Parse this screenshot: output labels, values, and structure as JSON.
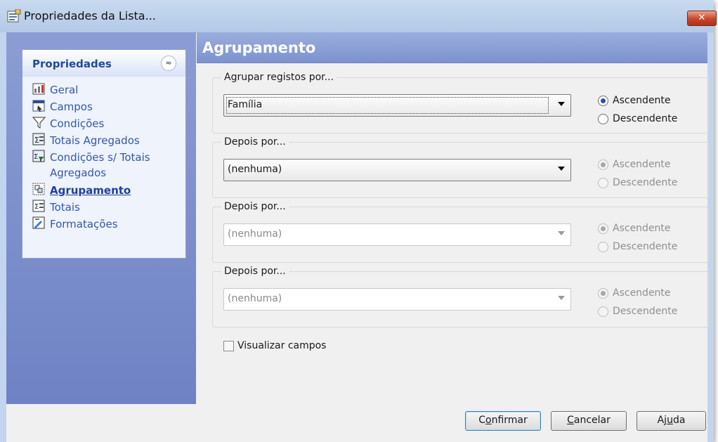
{
  "window": {
    "title": "Propriedades da Lista...",
    "close_glyph": "✕"
  },
  "sidebar": {
    "header": "Propriedades",
    "collapse_glyph": "≈",
    "items": [
      {
        "label": "Geral",
        "icon": "general-icon"
      },
      {
        "label": "Campos",
        "icon": "fields-icon"
      },
      {
        "label": "Condições",
        "icon": "filter-icon"
      },
      {
        "label": "Totais Agregados",
        "icon": "aggregate-totals-icon"
      },
      {
        "label_line1": "Condições s/ Totais",
        "label_line2": "Agregados",
        "icon": "aggregate-conditions-icon"
      },
      {
        "label": "Agrupamento",
        "icon": "grouping-icon",
        "active": true
      },
      {
        "label": "Totais",
        "icon": "totals-icon"
      },
      {
        "label": "Formatações",
        "icon": "formatting-icon"
      }
    ]
  },
  "content": {
    "title": "Agrupamento",
    "groups": [
      {
        "legend": "Agrupar registos por...",
        "value": "Família",
        "asc": "Ascendente",
        "desc": "Descendente",
        "selected": "asc",
        "enabled": true
      },
      {
        "legend": "Depois por...",
        "value": "(nenhuma)",
        "asc": "Ascendente",
        "desc": "Descendente",
        "selected": "asc",
        "enabled": true
      },
      {
        "legend": "Depois por...",
        "value": "(nenhuma)",
        "asc": "Ascendente",
        "desc": "Descendente",
        "selected": "asc",
        "enabled": false
      },
      {
        "legend": "Depois por...",
        "value": "(nenhuma)",
        "asc": "Ascendente",
        "desc": "Descendente",
        "selected": "asc",
        "enabled": false
      }
    ],
    "show_fields_label": "Visualizar campos"
  },
  "buttons": {
    "confirm_pre": "C",
    "confirm_u": "o",
    "confirm_post": "nfirmar",
    "cancel_pre": "",
    "cancel_u": "C",
    "cancel_post": "ancelar",
    "help_pre": "Aj",
    "help_u": "u",
    "help_post": "da"
  },
  "colors": {
    "accent": "#214a9c",
    "header_gradient_top": "#9aaedd",
    "sidebar_bg": "#7d90cc"
  }
}
